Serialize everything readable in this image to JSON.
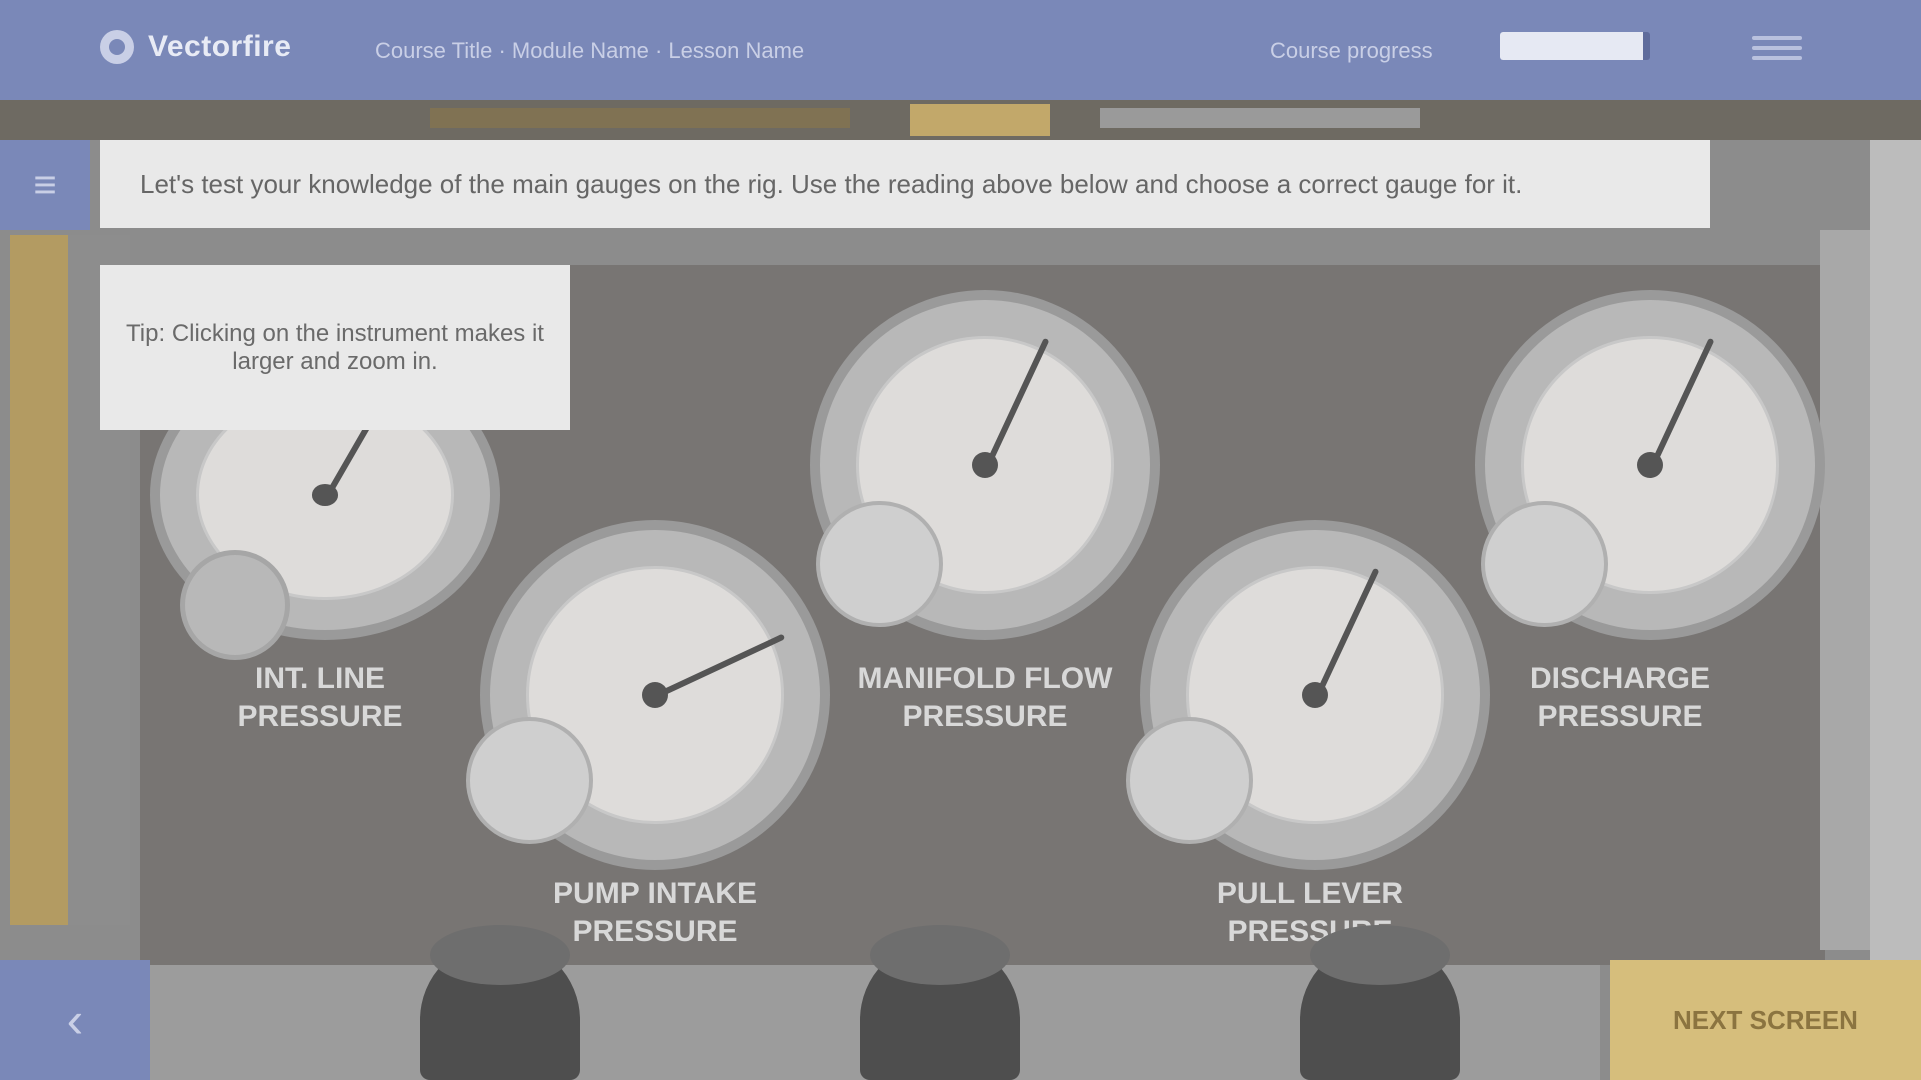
{
  "app": {
    "brand_name": "Vectorfire",
    "breadcrumb": "Course Title · Module Name · Lesson Name",
    "progress_label": "Course progress",
    "progress_fraction": 0.95
  },
  "banner": {
    "text": "Let's test your knowledge of the main gauges on the rig. Use the reading above below and choose a correct gauge for it."
  },
  "tooltip": {
    "text": "Tip: Clicking on the instrument makes it larger and zoom in."
  },
  "gauges": [
    {
      "label_line1": "INT. LINE",
      "label_line2": "PRESSURE"
    },
    {
      "label_line1": "MANIFOLD FLOW",
      "label_line2": "PRESSURE"
    },
    {
      "label_line1": "DISCHARGE",
      "label_line2": "PRESSURE"
    },
    {
      "label_line1": "PUMP INTAKE",
      "label_line2": "PRESSURE"
    },
    {
      "label_line1": "PULL LEVER",
      "label_line2": "PRESSURE"
    }
  ],
  "nav": {
    "back_icon": "chevron-left-icon",
    "next_label": "NEXT SCREEN"
  }
}
